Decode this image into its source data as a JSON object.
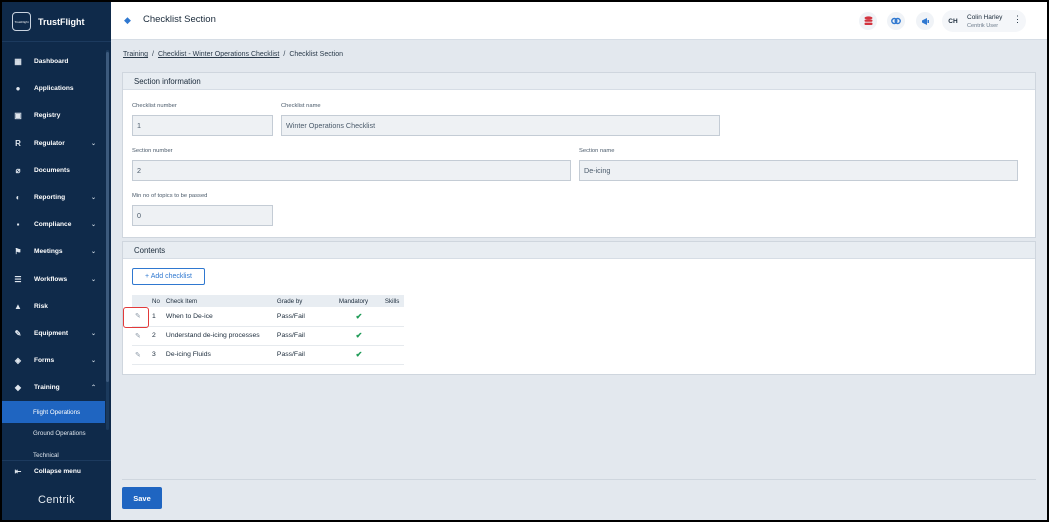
{
  "brand": {
    "name": "TrustFlight",
    "logo_text": "TrustFlight"
  },
  "sidebar": {
    "items": [
      {
        "label": "Dashboard",
        "icon": "▦"
      },
      {
        "label": "Applications",
        "icon": "●"
      },
      {
        "label": "Registry",
        "icon": "▣"
      },
      {
        "label": "Regulator",
        "icon": "R",
        "chevron": "⌄"
      },
      {
        "label": "Documents",
        "icon": "⌀"
      },
      {
        "label": "Reporting",
        "icon": "◐",
        "chevron": "⌄"
      },
      {
        "label": "Compliance",
        "icon": "▪",
        "chevron": "⌄"
      },
      {
        "label": "Meetings",
        "icon": "⚑",
        "chevron": "⌄"
      },
      {
        "label": "Workflows",
        "icon": "☰",
        "chevron": "⌄"
      },
      {
        "label": "Risk",
        "icon": "▲"
      },
      {
        "label": "Equipment",
        "icon": "✎",
        "chevron": "⌄"
      },
      {
        "label": "Forms",
        "icon": "◈",
        "chevron": "⌄"
      },
      {
        "label": "Training",
        "icon": "◆",
        "chevron": "⌃"
      }
    ],
    "sub_items": [
      {
        "label": "Flight Operations",
        "active": true
      },
      {
        "label": "Ground Operations",
        "active": false
      },
      {
        "label": "Technical",
        "active": false
      }
    ],
    "collapse_label": "Collapse menu",
    "collapse_icon": "⇤",
    "footer_logo": "Centrik"
  },
  "header": {
    "title": "Checklist Section",
    "icon": "◆",
    "user": {
      "initials": "CH",
      "name": "Colin Harley",
      "role": "Centrik User"
    }
  },
  "breadcrumb": {
    "items": [
      "Training",
      "Checklist - Winter Operations Checklist",
      "Checklist Section"
    ],
    "separator": "/"
  },
  "section_info": {
    "heading": "Section information",
    "checklist_number": {
      "label": "Checklist number",
      "value": "1"
    },
    "checklist_name": {
      "label": "Checklist name",
      "value": "Winter Operations Checklist"
    },
    "section_number": {
      "label": "Section number",
      "value": "2"
    },
    "section_name": {
      "label": "Section name",
      "value": "De-icing"
    },
    "min_topics": {
      "label": "Min no of topics to be passed",
      "value": "0"
    }
  },
  "contents": {
    "heading": "Contents",
    "add_button": "+ Add checklist",
    "columns": [
      "No",
      "Check Item",
      "Grade by",
      "Mandatory",
      "Skills"
    ],
    "rows": [
      {
        "no": "1",
        "item": "When to De-ice",
        "grade": "Pass/Fail",
        "mandatory": "✔"
      },
      {
        "no": "2",
        "item": "Understand de-icing processes",
        "grade": "Pass/Fail",
        "mandatory": "✔"
      },
      {
        "no": "3",
        "item": "De-icing Fluids",
        "grade": "Pass/Fail",
        "mandatory": "✔"
      }
    ],
    "edit_icon": "✎"
  },
  "save_label": "Save",
  "colors": {
    "sidebar": "#0f2a4a",
    "accent": "#1f65c1",
    "check": "#1c9a55",
    "highlight": "#e23a3a"
  }
}
